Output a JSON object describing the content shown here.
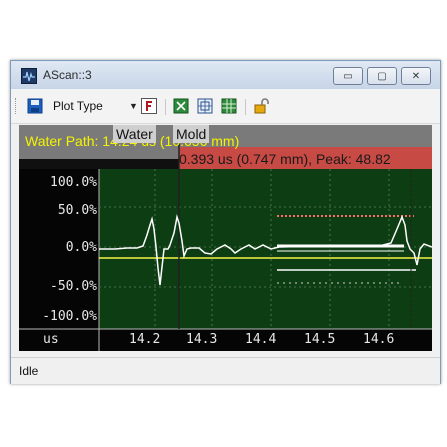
{
  "window": {
    "title": "AScan::3"
  },
  "toolbar": {
    "plot_type_label": "Plot Type",
    "icons": [
      "save-icon",
      "dropdown-chevron-icon",
      "fit-icon",
      "grid-icon",
      "zoom-fit-icon",
      "table-icon",
      "unlock-icon"
    ]
  },
  "plot": {
    "water_path_label": "Water Path: 14.24 us (10.656 mm)",
    "gate_labels": [
      "Water",
      "Mold"
    ],
    "measurement_label": "0.393 us (0.747 mm), Peak: 48.82",
    "y_ticks": [
      "100.0%",
      "50.0%",
      "0.0%",
      "-50.0%",
      "-100.0%"
    ],
    "x_unit": "us",
    "x_ticks": [
      "14.2",
      "14.3",
      "14.4",
      "14.5",
      "14.6"
    ],
    "colors": {
      "trace": "#ffffff",
      "gate": "#f5f542",
      "marker": "#ff6b6b",
      "background": "#0d3d12",
      "label_bar": "#c0392b"
    }
  },
  "status": {
    "text": "Idle"
  }
}
